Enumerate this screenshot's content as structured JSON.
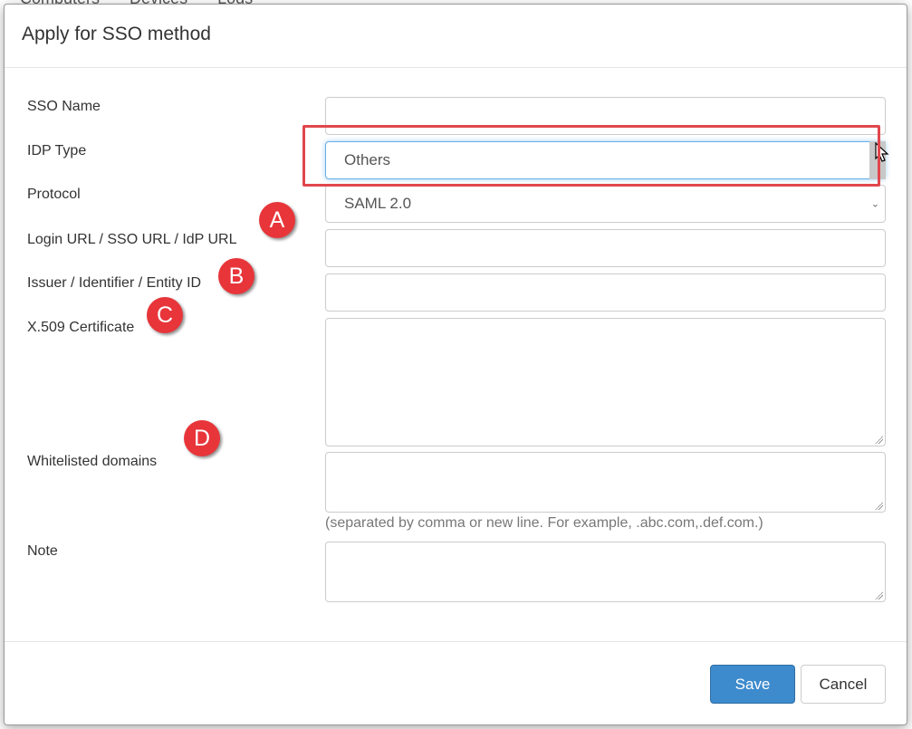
{
  "background": {
    "tabs": [
      "Computers",
      "Devices",
      "Logs"
    ]
  },
  "dialog": {
    "title": "Apply for SSO method",
    "fields": {
      "sso_name": {
        "label": "SSO Name",
        "value": ""
      },
      "idp_type": {
        "label": "IDP Type",
        "value": "Others"
      },
      "protocol": {
        "label": "Protocol",
        "value": "SAML 2.0"
      },
      "login_url": {
        "label": "Login URL / SSO URL / IdP URL",
        "value": ""
      },
      "issuer": {
        "label": "Issuer / Identifier / Entity ID",
        "value": ""
      },
      "certificate": {
        "label": "X.509 Certificate",
        "value": ""
      },
      "whitelisted": {
        "label": "Whitelisted domains",
        "value": "",
        "help": "(separated by comma or new line. For example, .abc.com,.def.com.)"
      },
      "note": {
        "label": "Note",
        "value": ""
      }
    },
    "buttons": {
      "save": "Save",
      "cancel": "Cancel"
    }
  },
  "annotations": {
    "markers": [
      "A",
      "B",
      "C",
      "D"
    ],
    "highlight_color": "#e0474c"
  },
  "colors": {
    "primary": "#3d8bcd",
    "marker": "#e8353a",
    "focus": "#66afe9"
  }
}
